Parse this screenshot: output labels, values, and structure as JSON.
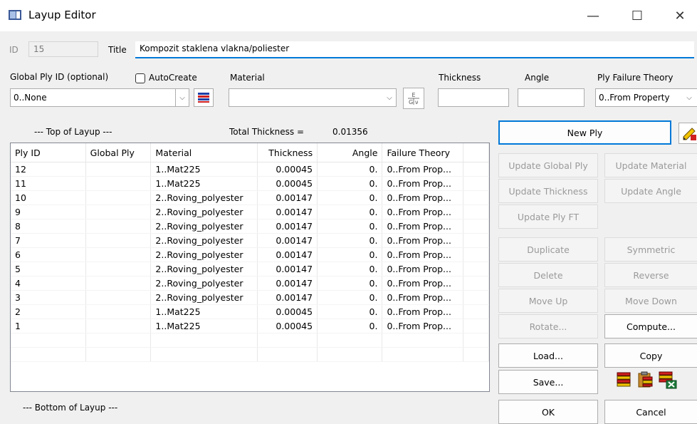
{
  "window": {
    "title": "Layup Editor",
    "minimize": "—",
    "maximize": "☐",
    "close": "✕"
  },
  "header": {
    "id_label": "ID",
    "id_value": "15",
    "title_label": "Title",
    "title_value": "Kompozit staklena vlakna/poliester"
  },
  "controls": {
    "global_ply_label": "Global Ply ID (optional)",
    "autocreate_label": "AutoCreate",
    "material_label": "Material",
    "thickness_label": "Thickness",
    "angle_label": "Angle",
    "ply_failure_label": "Ply Failure Theory",
    "global_ply_value": "0..None",
    "material_value": "",
    "thickness_value": "",
    "angle_value": "",
    "ply_failure_value": "0..From Property"
  },
  "layup": {
    "top_label": "--- Top of Layup ---",
    "bottom_label": "--- Bottom of Layup ---",
    "total_thickness_label": "Total Thickness =",
    "total_thickness_value": "0.01356",
    "columns": [
      "Ply ID",
      "Global Ply",
      "Material",
      "Thickness",
      "Angle",
      "Failure Theory"
    ],
    "rows": [
      [
        "12",
        "",
        "1..Mat225",
        "0.00045",
        "0.",
        "0..From Prop..."
      ],
      [
        "11",
        "",
        "1..Mat225",
        "0.00045",
        "0.",
        "0..From Prop..."
      ],
      [
        "10",
        "",
        "2..Roving_polyester",
        "0.00147",
        "0.",
        "0..From Prop..."
      ],
      [
        "9",
        "",
        "2..Roving_polyester",
        "0.00147",
        "0.",
        "0..From Prop..."
      ],
      [
        "8",
        "",
        "2..Roving_polyester",
        "0.00147",
        "0.",
        "0..From Prop..."
      ],
      [
        "7",
        "",
        "2..Roving_polyester",
        "0.00147",
        "0.",
        "0..From Prop..."
      ],
      [
        "6",
        "",
        "2..Roving_polyester",
        "0.00147",
        "0.",
        "0..From Prop..."
      ],
      [
        "5",
        "",
        "2..Roving_polyester",
        "0.00147",
        "0.",
        "0..From Prop..."
      ],
      [
        "4",
        "",
        "2..Roving_polyester",
        "0.00147",
        "0.",
        "0..From Prop..."
      ],
      [
        "3",
        "",
        "2..Roving_polyester",
        "0.00147",
        "0.",
        "0..From Prop..."
      ],
      [
        "2",
        "",
        "1..Mat225",
        "0.00045",
        "0.",
        "0..From Prop..."
      ],
      [
        "1",
        "",
        "1..Mat225",
        "0.00045",
        "0.",
        "0..From Prop..."
      ],
      [
        "",
        "",
        "",
        "",
        "",
        ""
      ],
      [
        "",
        "",
        "",
        "",
        "",
        ""
      ]
    ]
  },
  "buttons": {
    "new_ply": "New Ply",
    "update_global_ply": "Update Global Ply",
    "update_material": "Update Material",
    "update_thickness": "Update Thickness",
    "update_angle": "Update Angle",
    "update_ply_ft": "Update Ply FT",
    "duplicate": "Duplicate",
    "symmetric": "Symmetric",
    "delete": "Delete",
    "reverse": "Reverse",
    "move_up": "Move Up",
    "move_down": "Move Down",
    "rotate": "Rotate...",
    "compute": "Compute...",
    "load": "Load...",
    "copy": "Copy",
    "save": "Save...",
    "ok": "OK",
    "cancel": "Cancel"
  },
  "icons": {
    "global_ply_icon": "stack-icon",
    "material_icon": "material-e-g-nu-icon",
    "new_ply_icon": "pencil-icon",
    "copy_icons": [
      "layers-icon",
      "clipboard-icon",
      "excel-icon"
    ]
  }
}
